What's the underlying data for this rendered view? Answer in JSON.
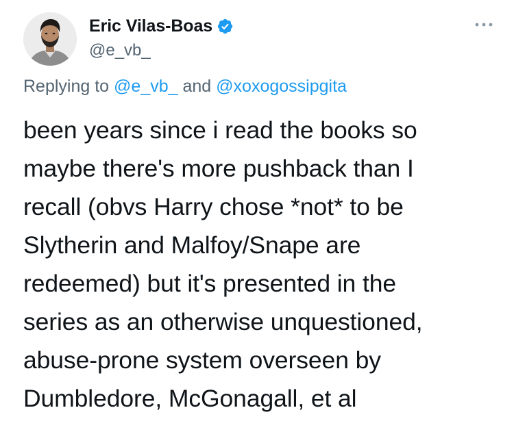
{
  "author": {
    "display_name": "Eric Vilas-Boas",
    "handle": "@e_vb_",
    "verified": true,
    "avatar_icon": "person-avatar"
  },
  "reply_context": {
    "prefix": "Replying to",
    "mention_1": "@e_vb_",
    "joiner": "and",
    "mention_2": "@xoxogossipgita"
  },
  "tweet": {
    "lines": [
      "been years since i read the books so",
      "maybe there's more pushback than I",
      "recall (obvs Harry chose *not* to be",
      "Slytherin and Malfoy/Snape are",
      "redeemed) but it's presented in the",
      "series as an otherwise unquestioned,",
      "abuse-prone system overseen by",
      "Dumbledore, McGonagall, et al"
    ]
  },
  "menu": {
    "icon": "more-horizontal-icon"
  },
  "colors": {
    "text": "#0f1419",
    "secondary": "#536471",
    "link": "#1d9bf0",
    "verified": "#1d9bf0",
    "background": "#ffffff"
  }
}
